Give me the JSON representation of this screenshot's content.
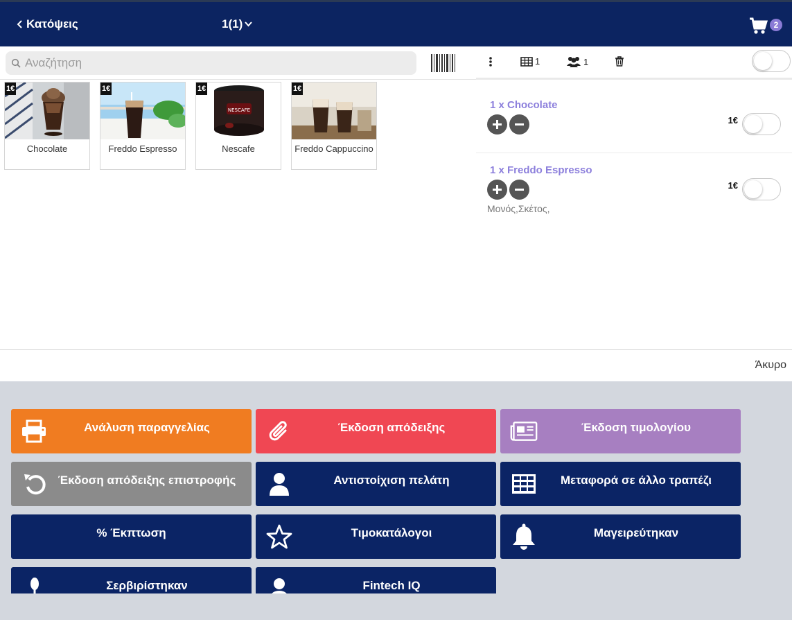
{
  "topbar": {
    "back_label": "Κατόψεις",
    "title": "1(1)",
    "cart_count": "2"
  },
  "search": {
    "placeholder": "Αναζήτηση"
  },
  "products": [
    {
      "name": "Chocolate",
      "price": "1€"
    },
    {
      "name": "Freddo Espresso",
      "price": "1€"
    },
    {
      "name": "Nescafe",
      "price": "1€"
    },
    {
      "name": "Freddo Cappuccino",
      "price": "1€"
    }
  ],
  "order_toolbar": {
    "table_count": "1",
    "guests_count": "1"
  },
  "order_items": [
    {
      "label": "1 x Chocolate",
      "price": "1€",
      "note": ""
    },
    {
      "label": "1 x Freddo Espresso",
      "price": "1€",
      "note": "Μονός,Σκέτος,"
    }
  ],
  "cancel_label": "Άκυρο",
  "actions": [
    {
      "label": "Ανάλυση παραγγελίας",
      "icon": "printer-icon",
      "color": "#f07c21"
    },
    {
      "label": "Έκδοση απόδειξης",
      "icon": "paperclip-icon",
      "color": "#f04753"
    },
    {
      "label": "Έκδοση τιμολογίου",
      "icon": "newspaper-icon",
      "color": "#a77fc1"
    },
    {
      "label": "Έκδοση απόδειξης επιστροφής",
      "icon": "undo-icon",
      "color": "#8b8b8b"
    },
    {
      "label": "Αντιστοίχιση πελάτη",
      "icon": "user-icon",
      "color": "#0b2465"
    },
    {
      "label": "Μεταφορά σε άλλο τραπέζι",
      "icon": "grid-icon",
      "color": "#0b2465"
    },
    {
      "label": "% Έκπτωση",
      "icon": "",
      "color": "#0b2465"
    },
    {
      "label": "Τιμοκατάλογοι",
      "icon": "star-icon",
      "color": "#0b2465"
    },
    {
      "label": "Μαγειρεύτηκαν",
      "icon": "bell-icon",
      "color": "#0b2465"
    },
    {
      "label": "Σερβιρίστηκαν",
      "icon": "spoon-icon",
      "color": "#0b2465"
    },
    {
      "label": "Fintech IQ",
      "icon": "user-icon",
      "color": "#0b2465"
    }
  ]
}
